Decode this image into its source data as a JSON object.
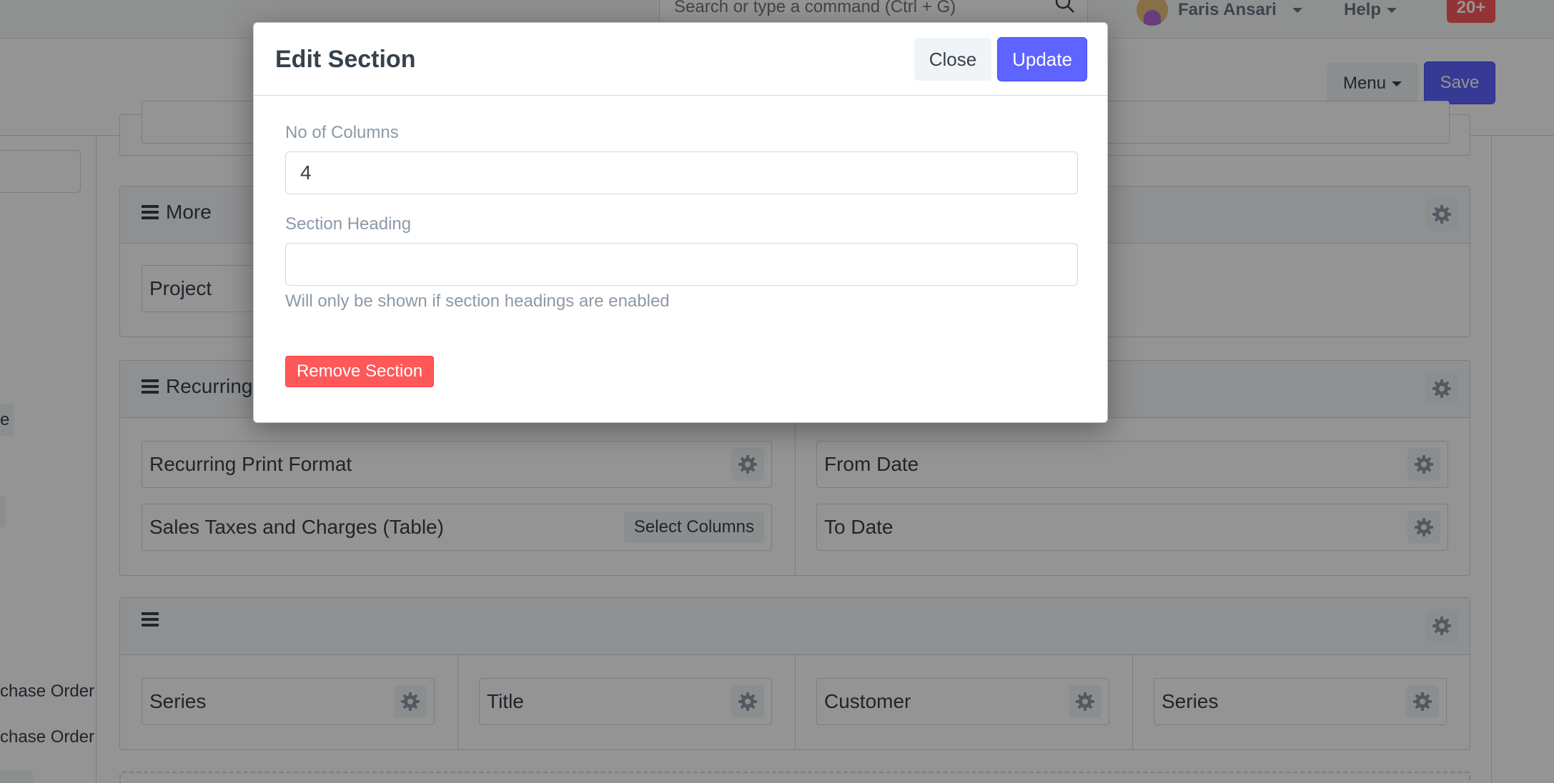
{
  "navbar": {
    "search_placeholder": "Search or type a command (Ctrl + G)",
    "user_name": "Faris Ansari",
    "help_label": "Help",
    "notifications_count": "20+"
  },
  "page_actions": {
    "menu_label": "Menu",
    "save_label": "Save"
  },
  "sidebar": {
    "chip_1": "e",
    "link_1": "chase Order",
    "link_2": "chase Order"
  },
  "sections": {
    "more": {
      "title": "More",
      "fields": [
        "Project"
      ]
    },
    "recurring": {
      "title": "Recurring",
      "left_fields": [
        "Recurring Print Format",
        "Sales Taxes and Charges (Table)"
      ],
      "select_columns_label": "Select Columns",
      "right_fields": [
        "From Date",
        "To Date"
      ]
    },
    "untitled": {
      "title": "",
      "fields": [
        "Series",
        "Title",
        "Customer",
        "Series"
      ]
    }
  },
  "modal": {
    "title": "Edit Section",
    "close_label": "Close",
    "update_label": "Update",
    "columns_label": "No of Columns",
    "columns_value": "4",
    "heading_label": "Section Heading",
    "heading_value": "",
    "heading_help": "Will only be shown if section headings are enabled",
    "remove_label": "Remove Section"
  },
  "colors": {
    "primary": "#5e64ff",
    "danger": "#ff5858",
    "overlay": "rgba(0,0,0,0.42)"
  }
}
